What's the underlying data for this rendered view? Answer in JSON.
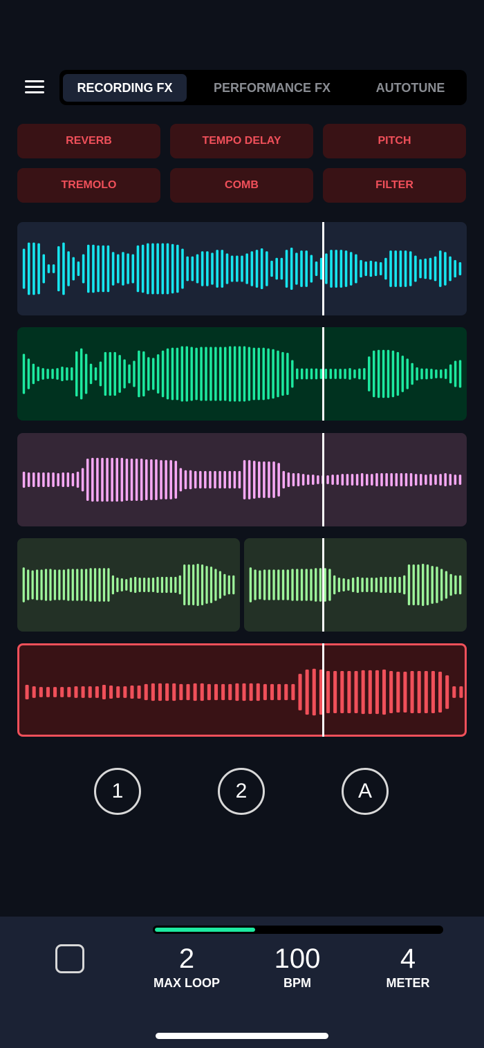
{
  "header": {
    "menu_icon": "hamburger-menu-icon",
    "tabs": [
      {
        "label": "RECORDING FX",
        "active": true
      },
      {
        "label": "PERFORMANCE FX",
        "active": false
      },
      {
        "label": "AUTOTUNE",
        "active": false
      }
    ]
  },
  "fx_buttons": [
    "REVERB",
    "TEMPO DELAY",
    "PITCH",
    "TREMOLO",
    "COMB",
    "FILTER"
  ],
  "colors": {
    "background": "#0d111a",
    "fx_button_bg": "#391215",
    "fx_button_text": "#f0505a",
    "progress": "#1de9a0"
  },
  "tracks": [
    {
      "name": "track-1",
      "bg": "#1b2335",
      "color": "#16e5ef",
      "amps": [
        0.55,
        0.72,
        0.72,
        0.7,
        0.4,
        0.12,
        0.12,
        0.62,
        0.72,
        0.48,
        0.32,
        0.2,
        0.4,
        0.66,
        0.66,
        0.64,
        0.64,
        0.64,
        0.46,
        0.4,
        0.46,
        0.42,
        0.4,
        0.64,
        0.66,
        0.7,
        0.7,
        0.7,
        0.7,
        0.7,
        0.68,
        0.66,
        0.55,
        0.34,
        0.34,
        0.4,
        0.48,
        0.48,
        0.44,
        0.52,
        0.52,
        0.42,
        0.36,
        0.36,
        0.36,
        0.42,
        0.48,
        0.52,
        0.56,
        0.48,
        0.22,
        0.3,
        0.3,
        0.52,
        0.58,
        0.44,
        0.5,
        0.5,
        0.38,
        0.2,
        0.3,
        0.42,
        0.52,
        0.52,
        0.52,
        0.5,
        0.46,
        0.4,
        0.24,
        0.2,
        0.22,
        0.2,
        0.18,
        0.3,
        0.5,
        0.5,
        0.5,
        0.5,
        0.48,
        0.36,
        0.26,
        0.28,
        0.3,
        0.34,
        0.5,
        0.46,
        0.34,
        0.24,
        0.18
      ]
    },
    {
      "name": "track-2",
      "bg": "#00321f",
      "color": "#1de9a0",
      "amps": [
        0.55,
        0.42,
        0.28,
        0.2,
        0.16,
        0.14,
        0.14,
        0.16,
        0.2,
        0.18,
        0.18,
        0.62,
        0.7,
        0.55,
        0.28,
        0.18,
        0.34,
        0.6,
        0.6,
        0.6,
        0.52,
        0.4,
        0.26,
        0.36,
        0.64,
        0.62,
        0.46,
        0.44,
        0.54,
        0.64,
        0.7,
        0.72,
        0.72,
        0.76,
        0.76,
        0.74,
        0.72,
        0.74,
        0.74,
        0.74,
        0.74,
        0.74,
        0.74,
        0.76,
        0.76,
        0.76,
        0.76,
        0.74,
        0.72,
        0.72,
        0.72,
        0.7,
        0.68,
        0.64,
        0.6,
        0.58,
        0.38,
        0.15,
        0.15,
        0.15,
        0.15,
        0.15,
        0.14,
        0.14,
        0.14,
        0.14,
        0.14,
        0.14,
        0.16,
        0.12,
        0.15,
        0.16,
        0.48,
        0.64,
        0.66,
        0.66,
        0.66,
        0.64,
        0.6,
        0.5,
        0.42,
        0.3,
        0.18,
        0.15,
        0.15,
        0.14,
        0.12,
        0.12,
        0.14,
        0.26,
        0.36,
        0.38
      ]
    },
    {
      "name": "track-3",
      "bg": "#342636",
      "color": "#f6a8f4",
      "amps": [
        0.22,
        0.2,
        0.2,
        0.2,
        0.2,
        0.2,
        0.2,
        0.18,
        0.2,
        0.2,
        0.18,
        0.22,
        0.32,
        0.58,
        0.6,
        0.6,
        0.6,
        0.6,
        0.6,
        0.6,
        0.6,
        0.58,
        0.58,
        0.58,
        0.58,
        0.56,
        0.56,
        0.56,
        0.54,
        0.54,
        0.54,
        0.52,
        0.32,
        0.26,
        0.26,
        0.24,
        0.24,
        0.24,
        0.24,
        0.24,
        0.24,
        0.24,
        0.24,
        0.24,
        0.24,
        0.54,
        0.54,
        0.52,
        0.5,
        0.5,
        0.5,
        0.5,
        0.46,
        0.24,
        0.2,
        0.18,
        0.18,
        0.16,
        0.14,
        0.14,
        0.12,
        0.12,
        0.12,
        0.14,
        0.14,
        0.16,
        0.16,
        0.16,
        0.16,
        0.18,
        0.16,
        0.16,
        0.18,
        0.18,
        0.18,
        0.18,
        0.18,
        0.18,
        0.18,
        0.18,
        0.16,
        0.16,
        0.14,
        0.16,
        0.14,
        0.16,
        0.18,
        0.16,
        0.14,
        0.14
      ]
    },
    {
      "name": "track-4a",
      "bg": "#233126",
      "color": "#9ef59b",
      "amps": [
        0.48,
        0.42,
        0.4,
        0.42,
        0.42,
        0.44,
        0.44,
        0.42,
        0.42,
        0.42,
        0.44,
        0.44,
        0.44,
        0.44,
        0.44,
        0.46,
        0.46,
        0.46,
        0.46,
        0.46,
        0.26,
        0.2,
        0.18,
        0.16,
        0.2,
        0.22,
        0.2,
        0.2,
        0.2,
        0.2,
        0.22,
        0.22,
        0.22,
        0.22,
        0.22,
        0.26,
        0.56,
        0.56,
        0.56,
        0.58,
        0.56,
        0.52,
        0.5,
        0.44,
        0.38,
        0.3,
        0.26,
        0.26
      ]
    },
    {
      "name": "track-4b",
      "bg": "#233126",
      "color": "#9ef59b",
      "amps": [
        0.48,
        0.42,
        0.4,
        0.42,
        0.42,
        0.42,
        0.42,
        0.42,
        0.42,
        0.44,
        0.44,
        0.44,
        0.44,
        0.44,
        0.46,
        0.46,
        0.46,
        0.44,
        0.26,
        0.2,
        0.18,
        0.16,
        0.2,
        0.22,
        0.2,
        0.2,
        0.2,
        0.2,
        0.22,
        0.22,
        0.22,
        0.22,
        0.22,
        0.26,
        0.56,
        0.56,
        0.56,
        0.58,
        0.56,
        0.52,
        0.5,
        0.44,
        0.38,
        0.3,
        0.26,
        0.26
      ]
    },
    {
      "name": "track-5-recording",
      "bg": "#391215",
      "color": "#f0505a",
      "recording": true,
      "amps": [
        0.2,
        0.16,
        0.14,
        0.14,
        0.14,
        0.14,
        0.14,
        0.16,
        0.16,
        0.16,
        0.16,
        0.2,
        0.18,
        0.16,
        0.16,
        0.18,
        0.18,
        0.22,
        0.24,
        0.24,
        0.24,
        0.24,
        0.22,
        0.22,
        0.24,
        0.24,
        0.22,
        0.22,
        0.22,
        0.22,
        0.24,
        0.24,
        0.24,
        0.24,
        0.22,
        0.22,
        0.22,
        0.22,
        0.22,
        0.5,
        0.62,
        0.64,
        0.62,
        0.58,
        0.58,
        0.58,
        0.58,
        0.58,
        0.6,
        0.6,
        0.6,
        0.62,
        0.58,
        0.56,
        0.56,
        0.58,
        0.58,
        0.58,
        0.58,
        0.56,
        0.46,
        0.16,
        0.16
      ]
    }
  ],
  "playhead_position": 0.68,
  "loop_buttons": [
    "1",
    "2",
    "A"
  ],
  "footer": {
    "stop_icon": "stop-square-icon",
    "progress": 0.35,
    "stats": [
      {
        "value": "2",
        "label": "MAX LOOP"
      },
      {
        "value": "100",
        "label": "BPM"
      },
      {
        "value": "4",
        "label": "METER"
      }
    ]
  }
}
